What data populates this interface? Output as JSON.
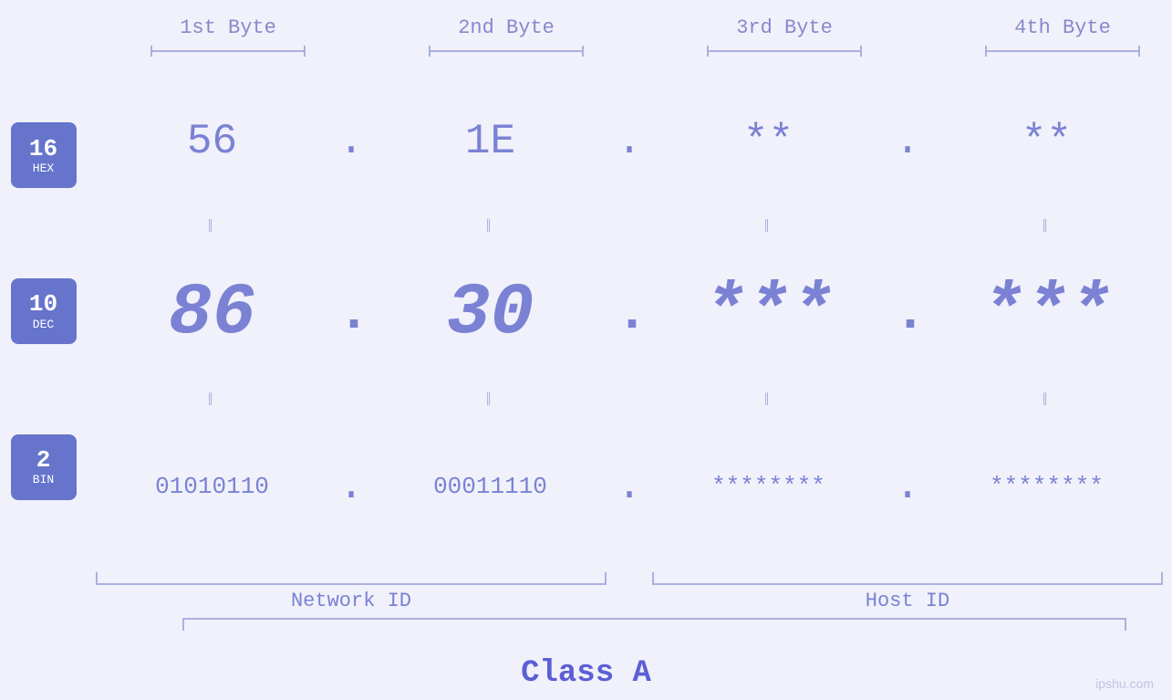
{
  "header": {
    "byte1": "1st Byte",
    "byte2": "2nd Byte",
    "byte3": "3rd Byte",
    "byte4": "4th Byte"
  },
  "badges": {
    "hex": {
      "num": "16",
      "label": "HEX"
    },
    "dec": {
      "num": "10",
      "label": "DEC"
    },
    "bin": {
      "num": "2",
      "label": "BIN"
    }
  },
  "hex_row": {
    "b1": "56",
    "b2": "1E",
    "b3": "**",
    "b4": "**"
  },
  "dec_row": {
    "b1": "86",
    "b2": "30",
    "b3": "***",
    "b4": "***"
  },
  "bin_row": {
    "b1": "01010110",
    "b2": "00011110",
    "b3": "********",
    "b4": "********"
  },
  "labels": {
    "network_id": "Network ID",
    "host_id": "Host ID",
    "class_a": "Class A"
  },
  "watermark": "ipshu.com",
  "dots": {
    "separator": "."
  }
}
